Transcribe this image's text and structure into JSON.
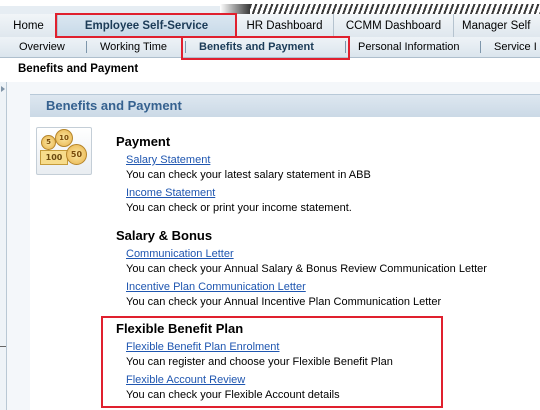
{
  "nav_level1": {
    "tabs": [
      {
        "label": "Home"
      },
      {
        "label": "Employee Self-Service",
        "active": true
      },
      {
        "label": "HR Dashboard"
      },
      {
        "label": "CCMM Dashboard"
      },
      {
        "label": "Manager Self"
      }
    ]
  },
  "nav_level2": {
    "tabs": [
      {
        "label": "Overview"
      },
      {
        "label": "Working Time"
      },
      {
        "label": "Benefits and Payment",
        "active": true
      },
      {
        "label": "Personal Information"
      },
      {
        "label": "Service I"
      }
    ]
  },
  "page": {
    "title": "Benefits and Payment"
  },
  "panel": {
    "title": "Benefits and Payment",
    "icon": "money-coins-icon",
    "icon_text": {
      "coin1": "5",
      "coin2": "10",
      "note": "100",
      "coin3": "50"
    },
    "sections": [
      {
        "title": "Payment",
        "items": [
          {
            "link": "Salary Statement",
            "description": "You can check your latest salary statement in ABB"
          },
          {
            "link": "Income Statement",
            "description": "You can check or print your income statement."
          }
        ]
      },
      {
        "title": "Salary & Bonus",
        "items": [
          {
            "link": "Communication Letter",
            "description": "You can check your Annual Salary & Bonus Review Communication Letter"
          },
          {
            "link": "Incentive Plan Communication Letter",
            "description": "You can check your Annual Incentive Plan Communication Letter"
          }
        ]
      },
      {
        "title": "Flexible Benefit Plan",
        "items": [
          {
            "link": "Flexible Benefit Plan Enrolment",
            "description": "You can register and choose your Flexible Benefit Plan"
          },
          {
            "link": "Flexible Account Review",
            "description": "You can check your Flexible Account details"
          }
        ]
      }
    ]
  },
  "colors": {
    "highlight": "#e0202e",
    "link": "#1f56b0",
    "panel_title": "#35618f"
  }
}
